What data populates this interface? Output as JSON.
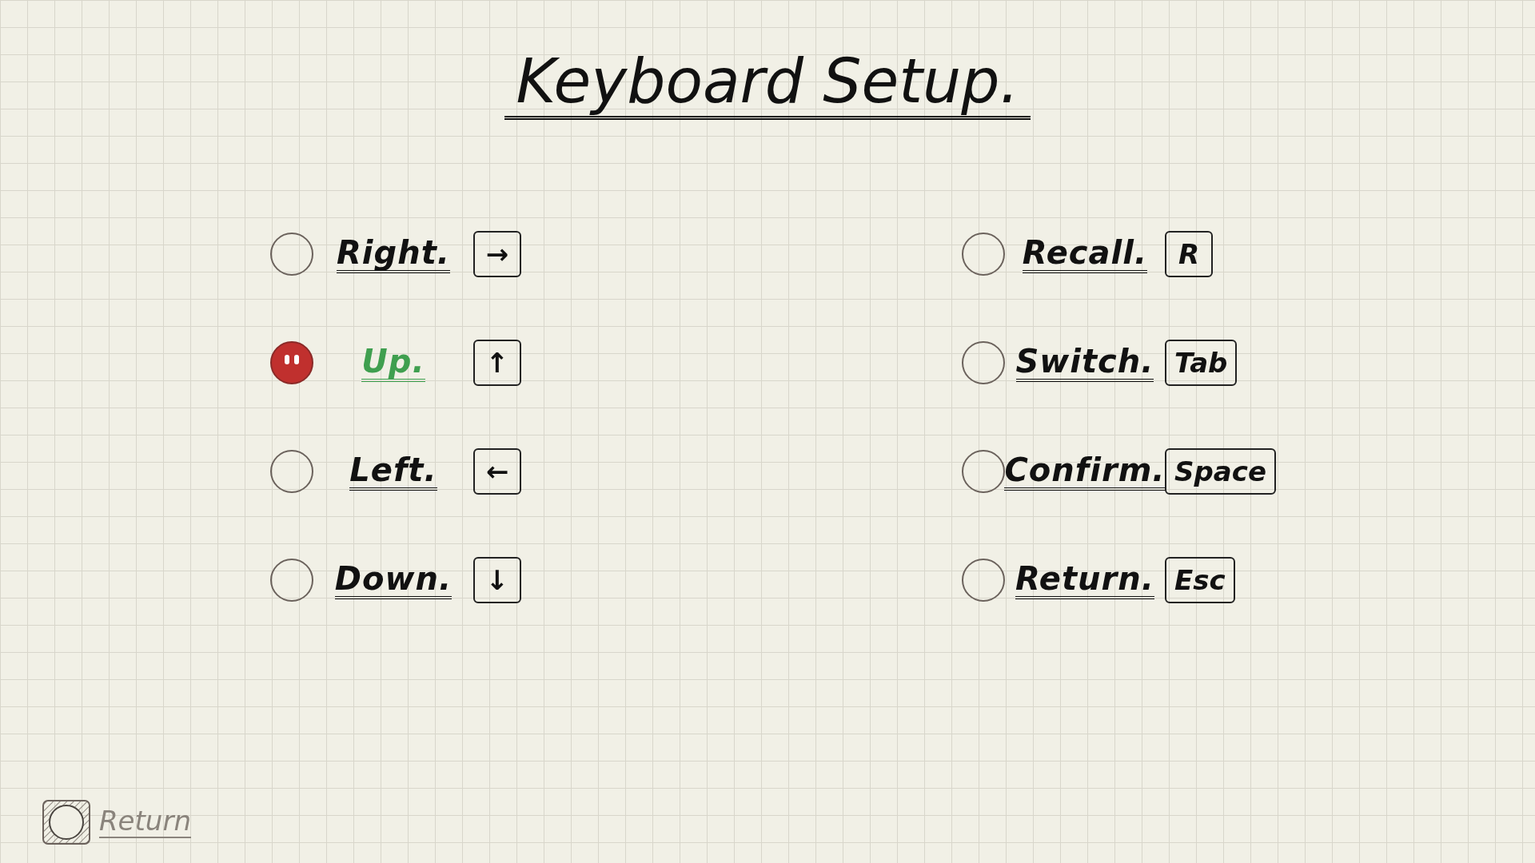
{
  "title": "Keyboard Setup.",
  "left_bindings": [
    {
      "label": "Right.",
      "key": "→",
      "selected": false
    },
    {
      "label": "Up.",
      "key": "↑",
      "selected": true
    },
    {
      "label": "Left.",
      "key": "←",
      "selected": false
    },
    {
      "label": "Down.",
      "key": "↓",
      "selected": false
    }
  ],
  "right_bindings": [
    {
      "label": "Recall.",
      "key": "R",
      "selected": false
    },
    {
      "label": "Switch.",
      "key": "Tab",
      "selected": false
    },
    {
      "label": "Confirm.",
      "key": "Space",
      "selected": false
    },
    {
      "label": "Return.",
      "key": "Esc",
      "selected": false
    }
  ],
  "back_button": {
    "label": "Return"
  }
}
